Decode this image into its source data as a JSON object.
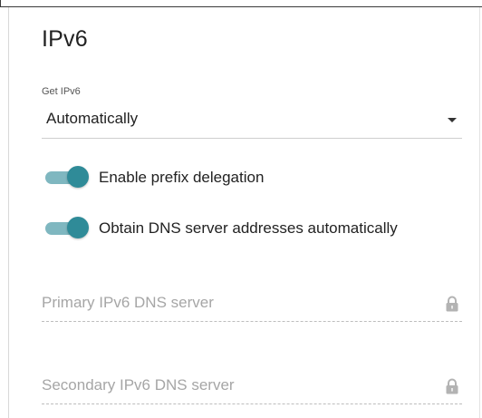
{
  "section": {
    "title": "IPv6"
  },
  "get_ipv6": {
    "label": "Get IPv6",
    "value": "Automatically"
  },
  "toggles": [
    {
      "label": "Enable prefix delegation",
      "enabled": true
    },
    {
      "label": "Obtain DNS server addresses automatically",
      "enabled": true
    }
  ],
  "dns": {
    "primary_placeholder": "Primary IPv6 DNS server",
    "secondary_placeholder": "Secondary IPv6 DNS server"
  },
  "colors": {
    "toggle_track": "#7fb7c0",
    "toggle_knob": "#2f8b98"
  },
  "icons": {
    "select": "chevron-down-icon",
    "locked_field": "lock-icon"
  }
}
